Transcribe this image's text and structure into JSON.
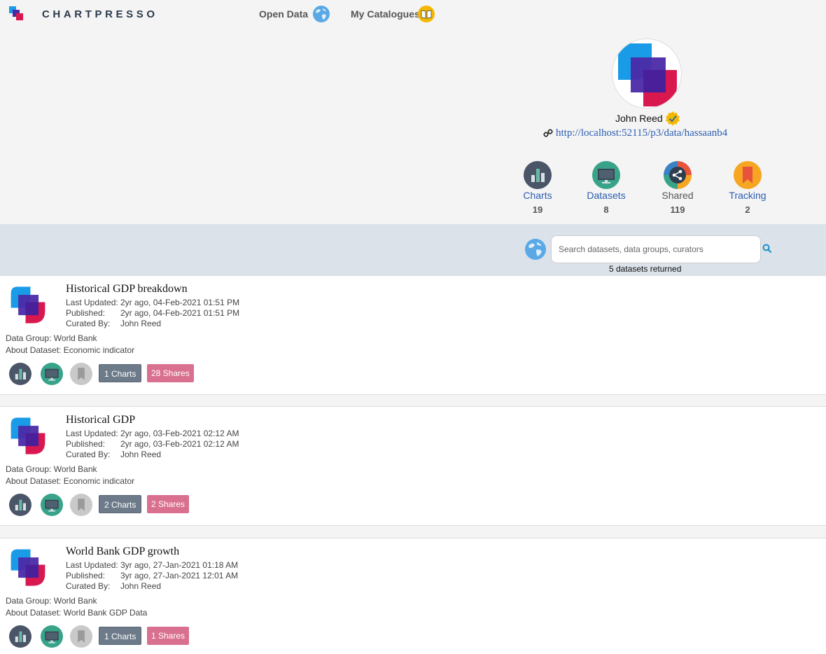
{
  "nav": {
    "brand": "CHARTPRESSO",
    "open_data": "Open Data",
    "my_catalogues": "My Catalogues"
  },
  "profile": {
    "name": "John Reed",
    "link": "http://localhost:52115/p3/data/hassaanb4"
  },
  "stats": [
    {
      "label": "Charts",
      "count": "19",
      "color": "#4a5568"
    },
    {
      "label": "Datasets",
      "count": "8",
      "color": "#38a389"
    },
    {
      "label": "Shared",
      "count": "119",
      "color": "#e8533b"
    },
    {
      "label": "Tracking",
      "count": "2",
      "color": "#f6a623"
    }
  ],
  "search": {
    "placeholder": "Search datasets, data groups, curators",
    "results": "5 datasets returned"
  },
  "labels": {
    "last_updated": "Last Updated:",
    "published": "Published:",
    "curated_by": "Curated By:",
    "data_group": "Data Group:",
    "about": "About Dataset:"
  },
  "datasets": [
    {
      "title": "Historical GDP breakdown",
      "last_updated": "2yr ago, 04-Feb-2021 01:51 PM",
      "published": "2yr ago, 04-Feb-2021 01:51 PM",
      "curated_by": "John Reed",
      "data_group": "World Bank",
      "about": "Economic indicator",
      "charts_btn": "1 Charts",
      "shares_btn": "28 Shares"
    },
    {
      "title": "Historical GDP",
      "last_updated": "2yr ago, 03-Feb-2021 02:12 AM",
      "published": "2yr ago, 03-Feb-2021 02:12 AM",
      "curated_by": "John Reed",
      "data_group": "World Bank",
      "about": "Economic indicator",
      "charts_btn": "2 Charts",
      "shares_btn": "2 Shares"
    },
    {
      "title": "World Bank GDP growth",
      "last_updated": "3yr ago, 27-Jan-2021 01:18 AM",
      "published": "3yr ago, 27-Jan-2021 12:01 AM",
      "curated_by": "John Reed",
      "data_group": "World Bank",
      "about": "World Bank GDP Data",
      "charts_btn": "1 Charts",
      "shares_btn": "1 Shares"
    }
  ],
  "colors": {
    "brand_blue": "#1a9be8",
    "brand_purple": "#4b2aa8",
    "brand_pink": "#d9184f",
    "link": "#2a5db0",
    "charts_btn": "#6c7a89",
    "shares_btn": "#d9708f",
    "search_band": "#dbe2ea"
  }
}
